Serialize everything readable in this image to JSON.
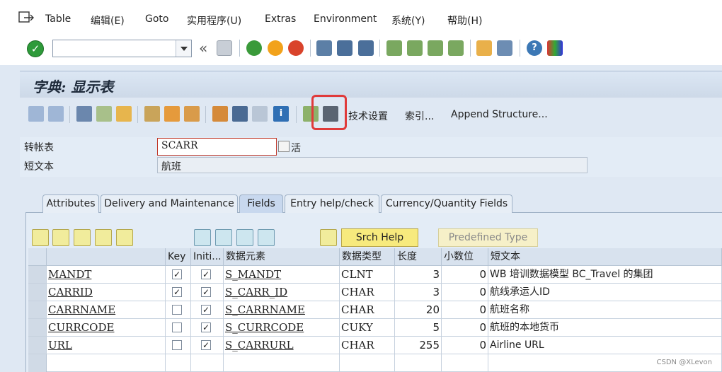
{
  "menu": [
    "Table",
    "编辑(E)",
    "Goto",
    "实用程序(U)",
    "Extras",
    "Environment",
    "系统(Y)",
    "帮助(H)"
  ],
  "command_field": {
    "value": ""
  },
  "title": "字典: 显示表",
  "app_toolbar": {
    "tech_settings": "技术设置",
    "indexes": "索引...",
    "append_structure": "Append Structure..."
  },
  "header": {
    "table_label": "转帐表",
    "table_value": "SCARR",
    "status": "活",
    "short_text_label": "短文本",
    "short_text_value": "航班"
  },
  "tabs": [
    {
      "label": "Attributes",
      "active": false
    },
    {
      "label": "Delivery and Maintenance",
      "active": false
    },
    {
      "label": "Fields",
      "active": true
    },
    {
      "label": "Entry help/check",
      "active": false
    },
    {
      "label": "Currency/Quantity Fields",
      "active": false
    }
  ],
  "buttons": {
    "srch_help": "Srch Help",
    "predefined_type": "Predefined Type"
  },
  "columns": [
    "",
    "Key",
    "Initi...",
    "数据元素",
    "数据类型",
    "长度",
    "小数位",
    "短文本"
  ],
  "rows": [
    {
      "field": "MANDT",
      "key": true,
      "init": true,
      "element": "S_MANDT",
      "type": "CLNT",
      "length": "3",
      "decimals": "0",
      "text": "WB 培训数据模型 BC_Travel 的集团"
    },
    {
      "field": "CARRID",
      "key": true,
      "init": true,
      "element": "S_CARR_ID",
      "type": "CHAR",
      "length": "3",
      "decimals": "0",
      "text": "航线承运人ID"
    },
    {
      "field": "CARRNAME",
      "key": false,
      "init": true,
      "element": "S_CARRNAME",
      "type": "CHAR",
      "length": "20",
      "decimals": "0",
      "text": "航班名称"
    },
    {
      "field": "CURRCODE",
      "key": false,
      "init": true,
      "element": "S_CURRCODE",
      "type": "CUKY",
      "length": "5",
      "decimals": "0",
      "text": "航班的本地货币"
    },
    {
      "field": "URL",
      "key": false,
      "init": true,
      "element": "S_CARRURL",
      "type": "CHAR",
      "length": "255",
      "decimals": "0",
      "text": "Airline URL"
    }
  ],
  "watermark": "CSDN @XLevon",
  "colors": {
    "highlight": "#e03a3a",
    "title_bg": "#cdd9e8",
    "panel_bg": "#e3ecf6"
  }
}
